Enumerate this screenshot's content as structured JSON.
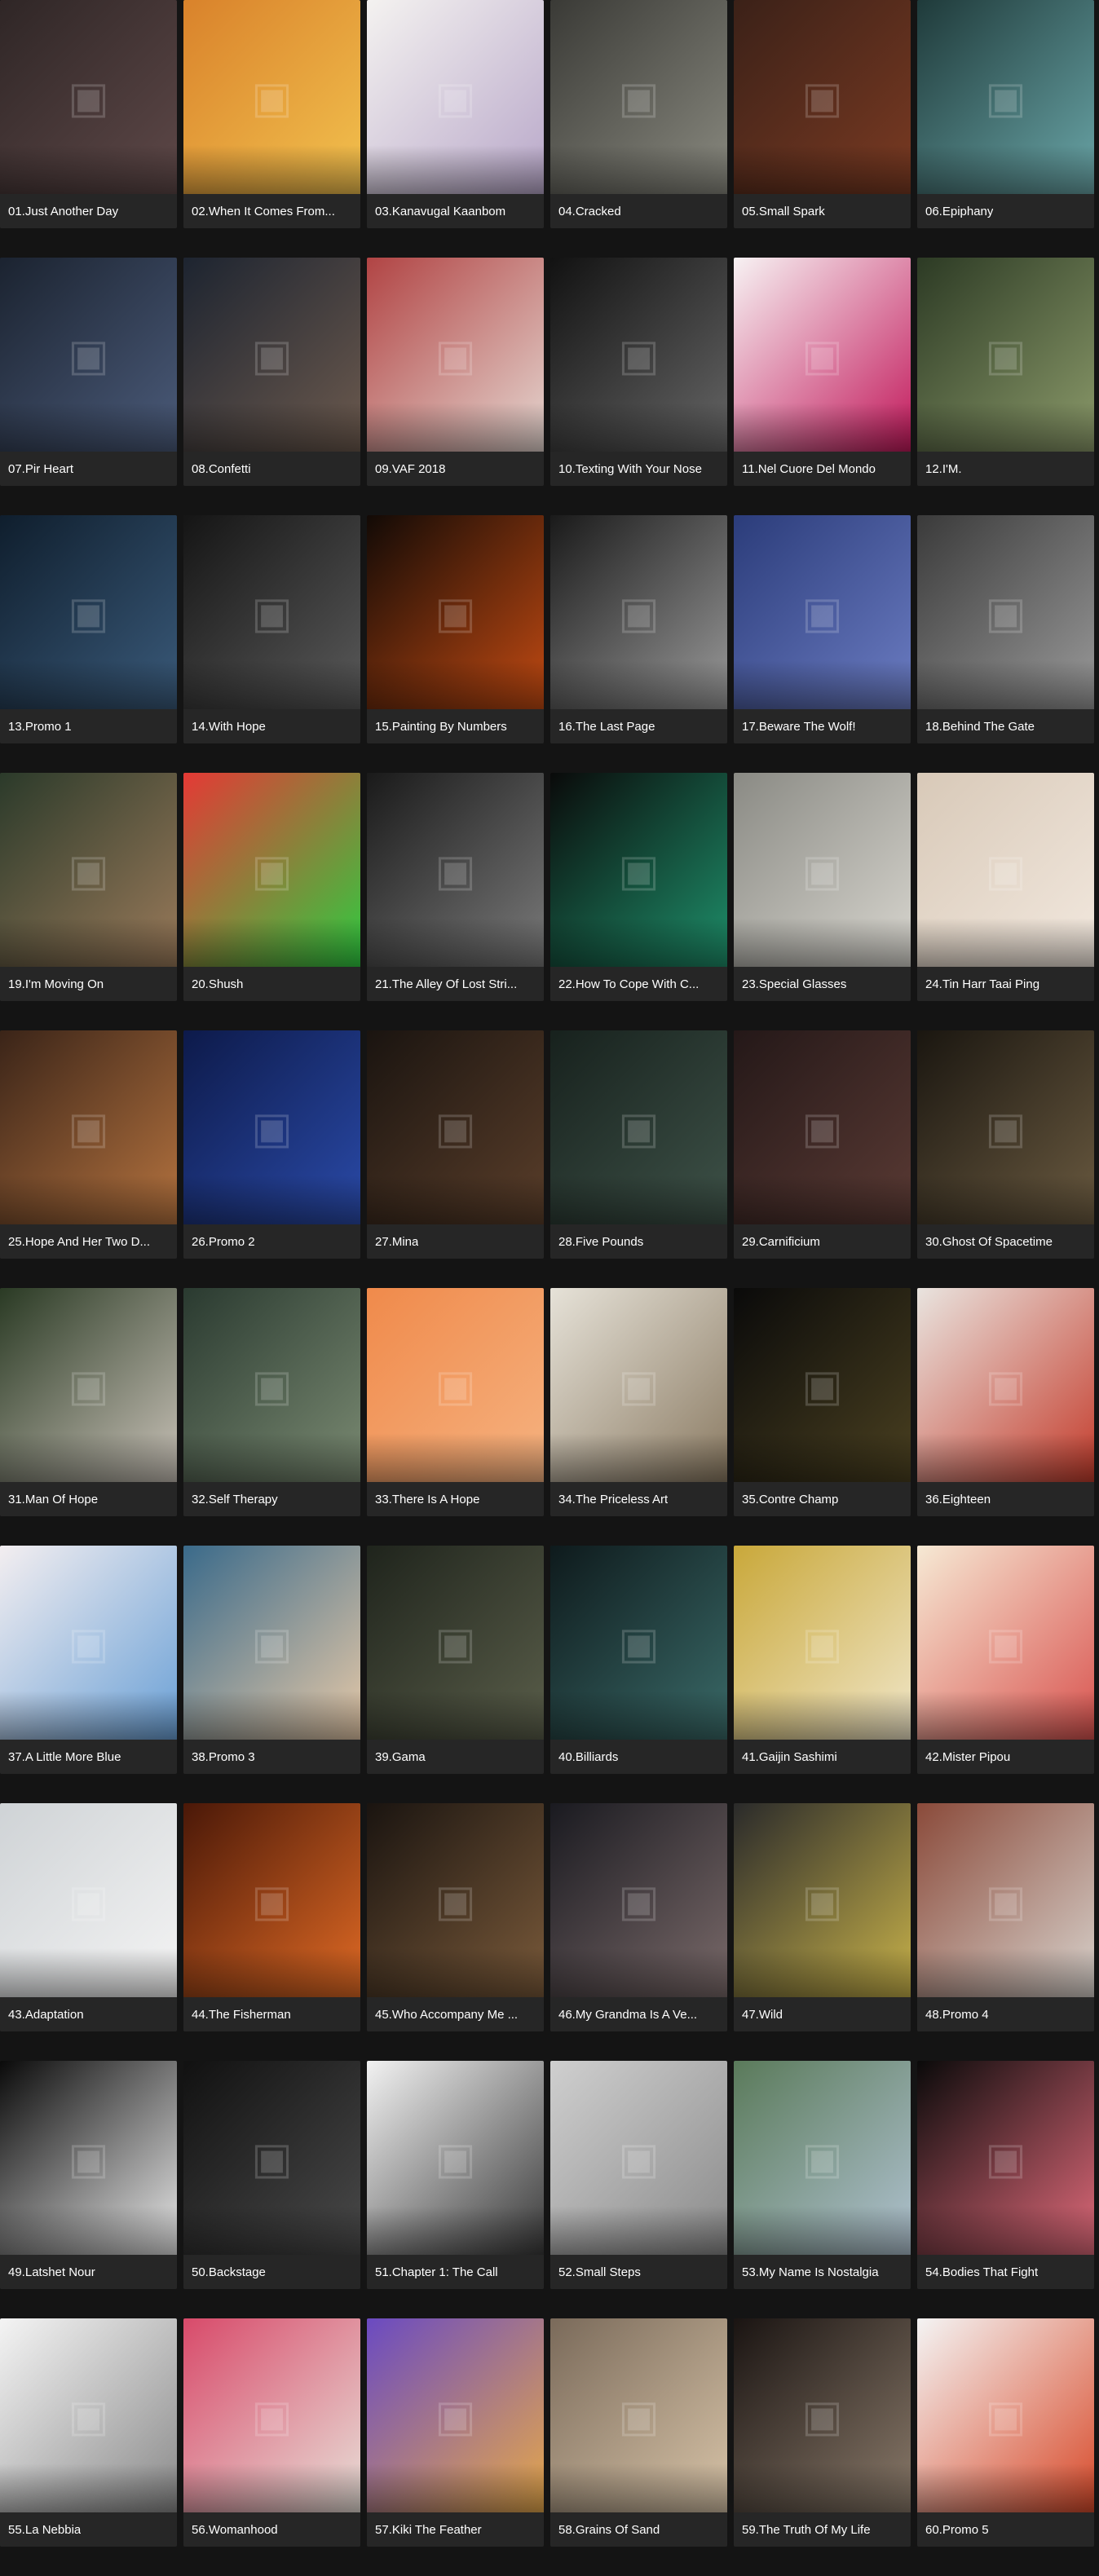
{
  "films": [
    {
      "label": "01.Just Another Day",
      "colors": [
        "#2f2626",
        "#5e4848"
      ]
    },
    {
      "label": "02.When It Comes From...",
      "colors": [
        "#d9822b",
        "#f2c14e"
      ]
    },
    {
      "label": "03.Kanavugal Kaanbom",
      "colors": [
        "#f4f2f0",
        "#b8a7c9"
      ]
    },
    {
      "label": "04.Cracked",
      "colors": [
        "#3a3a36",
        "#8a8a80"
      ]
    },
    {
      "label": "05.Small Spark",
      "colors": [
        "#3b2118",
        "#7a3a22"
      ]
    },
    {
      "label": "06.Epiphany",
      "colors": [
        "#1f3a3a",
        "#6aa6a8"
      ]
    },
    {
      "label": "07.Pir Heart",
      "colors": [
        "#1b2330",
        "#4b5b7a"
      ]
    },
    {
      "label": "08.Confetti",
      "colors": [
        "#1d2430",
        "#6c5a4e"
      ]
    },
    {
      "label": "09.VAF 2018",
      "colors": [
        "#b14444",
        "#e5d6d0"
      ]
    },
    {
      "label": "10.Texting With Your Nose",
      "colors": [
        "#121212",
        "#666666"
      ]
    },
    {
      "label": "11.Nel Cuore Del Mondo",
      "colors": [
        "#f7f2f3",
        "#c2185b"
      ]
    },
    {
      "label": "12.I'M.",
      "colors": [
        "#2c3a24",
        "#8b9a6a"
      ]
    },
    {
      "label": "13.Promo 1",
      "colors": [
        "#0f1e2d",
        "#3a5a7a"
      ]
    },
    {
      "label": "14.With Hope",
      "colors": [
        "#151515",
        "#5a5a5a"
      ]
    },
    {
      "label": "15.Painting By Numbers",
      "colors": [
        "#120a06",
        "#c24a12"
      ]
    },
    {
      "label": "16.The Last Page",
      "colors": [
        "#1a1a1a",
        "#9a9a9a"
      ]
    },
    {
      "label": "17.Beware The Wolf!",
      "colors": [
        "#2b3c7a",
        "#6b7cc2"
      ]
    },
    {
      "label": "18.Behind The Gate",
      "colors": [
        "#3a3a3a",
        "#9a9a9a"
      ]
    },
    {
      "label": "19.I'm Moving On",
      "colors": [
        "#2b3a2a",
        "#9a7a5a"
      ]
    },
    {
      "label": "20.Shush",
      "colors": [
        "#e53935",
        "#2ecc40"
      ]
    },
    {
      "label": "21.The Alley Of Lost Stri...",
      "colors": [
        "#1a1a1a",
        "#7a7a7a"
      ]
    },
    {
      "label": "22.How To Cope With C...",
      "colors": [
        "#0a0a0a",
        "#1e8f6a"
      ]
    },
    {
      "label": "23.Special Glasses",
      "colors": [
        "#8a8a84",
        "#d8d6cf"
      ]
    },
    {
      "label": "24.Tin Harr Taai Ping",
      "colors": [
        "#d8c9b8",
        "#f2e8de"
      ]
    },
    {
      "label": "25.Hope And Her Two D...",
      "colors": [
        "#3a2418",
        "#b5733f"
      ]
    },
    {
      "label": "26.Promo 2",
      "colors": [
        "#0d1a4a",
        "#2a4aa8"
      ]
    },
    {
      "label": "27.Mina",
      "colors": [
        "#1a1410",
        "#5a3e2a"
      ]
    },
    {
      "label": "28.Five Pounds",
      "colors": [
        "#17211d",
        "#3e5248"
      ]
    },
    {
      "label": "29.Carnificium",
      "colors": [
        "#241818",
        "#5a3a34"
      ]
    },
    {
      "label": "30.Ghost Of Spacetime",
      "colors": [
        "#1a1610",
        "#6a5a40"
      ]
    },
    {
      "label": "31.Man Of Hope",
      "colors": [
        "#2a3a24",
        "#c9c2b8"
      ]
    },
    {
      "label": "32.Self Therapy",
      "colors": [
        "#2a3a30",
        "#7a8a72"
      ]
    },
    {
      "label": "33.There Is A Hope",
      "colors": [
        "#f08a4b",
        "#f5b280"
      ]
    },
    {
      "label": "34.The Priceless Art",
      "colors": [
        "#e6e2d8",
        "#8a7a62"
      ]
    },
    {
      "label": "35.Contre Champ",
      "colors": [
        "#0a0a0a",
        "#4a4020"
      ]
    },
    {
      "label": "36.Eighteen",
      "colors": [
        "#e9e4df",
        "#c43c2c"
      ]
    },
    {
      "label": "37.A Little More Blue",
      "colors": [
        "#f3eef0",
        "#6aa0d6"
      ]
    },
    {
      "label": "38.Promo 3",
      "colors": [
        "#3a6a8a",
        "#e6c9a8"
      ]
    },
    {
      "label": "39.Gama",
      "colors": [
        "#1f241c",
        "#5a5e4a"
      ]
    },
    {
      "label": "40.Billiards",
      "colors": [
        "#0e1a1c",
        "#3a6a68"
      ]
    },
    {
      "label": "41.Gaijin Sashimi",
      "colors": [
        "#c9a83a",
        "#f0e6c8"
      ]
    },
    {
      "label": "42.Mister Pipou",
      "colors": [
        "#f6e9d4",
        "#d9534f"
      ]
    },
    {
      "label": "43.Adaptation",
      "colors": [
        "#cfd3d6",
        "#f4f4f4"
      ]
    },
    {
      "label": "44.The Fisherman",
      "colors": [
        "#4a1808",
        "#e06a24"
      ]
    },
    {
      "label": "45.Who Accompany Me ...",
      "colors": [
        "#1a1410",
        "#7a5a3a"
      ]
    },
    {
      "label": "46.My Grandma Is A Ve...",
      "colors": [
        "#1a1a20",
        "#7a6a6a"
      ]
    },
    {
      "label": "47.Wild",
      "colors": [
        "#2a2a2a",
        "#c8b24a"
      ]
    },
    {
      "label": "48.Promo 4",
      "colors": [
        "#8a4a3a",
        "#d8d2cc"
      ]
    },
    {
      "label": "49.Latshet Nour",
      "colors": [
        "#0a0a0a",
        "#e8e8e8"
      ]
    },
    {
      "label": "50.Backstage",
      "colors": [
        "#111111",
        "#4a4a4a"
      ]
    },
    {
      "label": "51.Chapter 1: The Call",
      "colors": [
        "#f2f2f2",
        "#3a3a3a"
      ]
    },
    {
      "label": "52.Small Steps",
      "colors": [
        "#cfcfcf",
        "#8a8a8a"
      ]
    },
    {
      "label": "53.My Name Is Nostalgia",
      "colors": [
        "#5a7a5a",
        "#b0c2d0"
      ]
    },
    {
      "label": "54.Bodies That Fight",
      "colors": [
        "#0a0a0a",
        "#e06a7a"
      ]
    },
    {
      "label": "55.La Nebbia",
      "colors": [
        "#f4f4f4",
        "#8a8a8a"
      ]
    },
    {
      "label": "56.Womanhood",
      "colors": [
        "#d84a6a",
        "#e8e0d8"
      ]
    },
    {
      "label": "57.Kiki The Feather",
      "colors": [
        "#6a4ac2",
        "#e6a84a"
      ]
    },
    {
      "label": "58.Grains Of Sand",
      "colors": [
        "#7a6a5a",
        "#d8c4a8"
      ]
    },
    {
      "label": "59.The Truth Of My Life",
      "colors": [
        "#1a1412",
        "#8a7a6a"
      ]
    },
    {
      "label": "60.Promo 5",
      "colors": [
        "#f4f4f4",
        "#d84a2a"
      ]
    }
  ]
}
